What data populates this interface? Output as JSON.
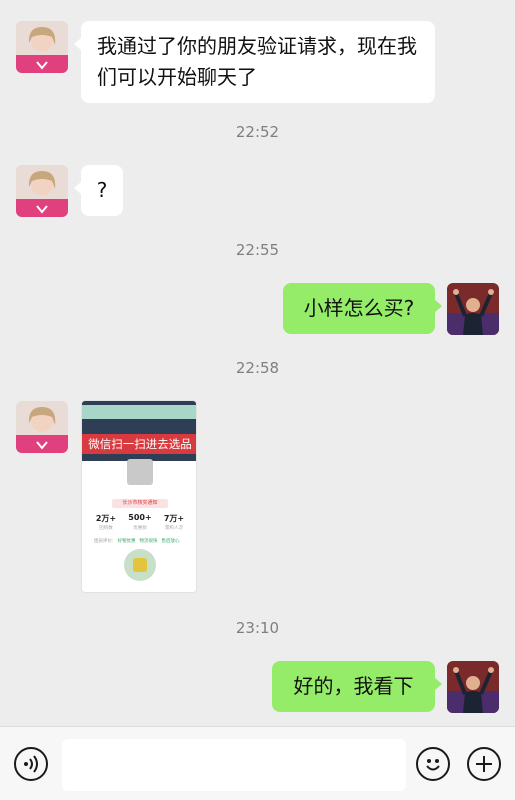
{
  "messages": {
    "m1": {
      "text": "我通过了你的朋友验证请求，现在我们可以开始聊天了"
    },
    "m2": {
      "text": "?"
    },
    "m3": {
      "text": "小样怎么买?"
    },
    "m5": {
      "text": "好的，我看下"
    }
  },
  "timestamps": [
    "22:52",
    "22:55",
    "22:58",
    "23:10"
  ],
  "image_card": {
    "banner": "微信扫一扫进去选品",
    "tag": "长沙市核实通知",
    "stats": [
      {
        "value": "2万+",
        "label": "团购数"
      },
      {
        "value": "500+",
        "label": "优惠款"
      },
      {
        "value": "7万+",
        "label": "累积人次"
      }
    ],
    "rating_label": "团员评价:",
    "ratings": [
      "好物优惠",
      "物流很快",
      "售后放心"
    ]
  },
  "input_bar": {
    "placeholder": ""
  },
  "icons": {
    "voice": "voice-icon",
    "emoji": "emoji-icon",
    "plus": "plus-icon"
  },
  "colors": {
    "outgoing_bubble": "#95ec69",
    "incoming_bubble": "#ffffff",
    "background": "#ededed"
  }
}
